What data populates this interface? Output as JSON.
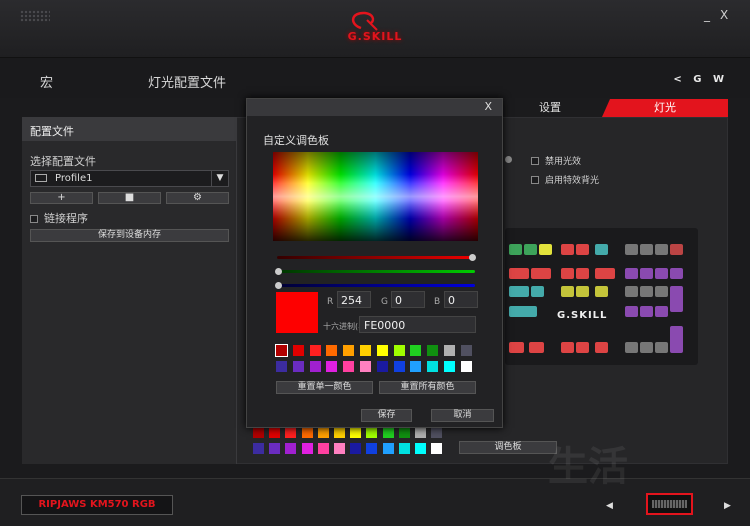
{
  "window": {
    "logo_text": "G.SKILL",
    "minimize": "_",
    "close": "X"
  },
  "nav": {
    "macro": "宏",
    "lighting_profile": "灯光配置文件",
    "right_text": "< G W"
  },
  "tabs": {
    "settings": "设置",
    "lighting": "灯光"
  },
  "profile_panel": {
    "title": "配置文件",
    "select_label": "选择配置文件",
    "selected_profile": "Profile1",
    "add_btn": "+",
    "delete_btn": "■",
    "settings_btn": "⚙",
    "link_program": "链接程序",
    "save_to_device": "保存到设备内存"
  },
  "options": {
    "disable_effect": "禁用光效",
    "enable_special": "启用特效背光"
  },
  "palette_button": "调色板",
  "footer": {
    "model": "RIPJAWS KM570 RGB",
    "prev": "◀",
    "next": "▶"
  },
  "dialog": {
    "close": "X",
    "title": "自定义调色板",
    "r_label": "R",
    "r_value": "254",
    "g_label": "G",
    "g_value": "0",
    "b_label": "B",
    "b_value": "0",
    "hex_label": "十六进制(#)",
    "hex_value": "FE0000",
    "preview_color": "#fe0000",
    "reset_single": "重置单一颜色",
    "reset_all": "重置所有颜色",
    "save": "保存",
    "cancel": "取消"
  },
  "colors": {
    "accent": "#e3141d",
    "swatches_row1": [
      "#b00000",
      "#e00000",
      "#ff2020",
      "#ff6a00",
      "#ffa000",
      "#ffd000",
      "#ffff00",
      "#a0ff00",
      "#20d020",
      "#109010",
      "#b0b0b0",
      "#505060"
    ],
    "swatches_row2": [
      "#3c2ca0",
      "#6a2cc0",
      "#a020d0",
      "#e020e0",
      "#ff40a0",
      "#ff80c0",
      "#1a1aa0",
      "#1040e0",
      "#20a0ff",
      "#00e0e0",
      "#00ffff",
      "#ffffff"
    ]
  },
  "watermark": "生活"
}
